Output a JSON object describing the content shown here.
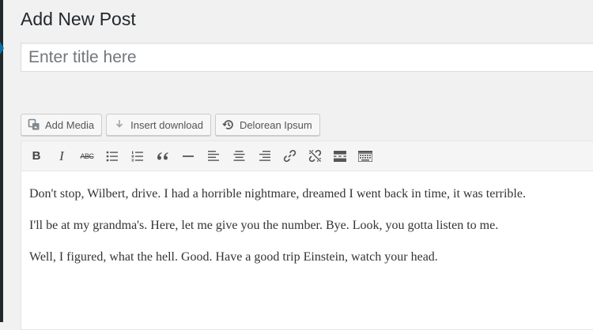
{
  "page": {
    "title": "Add New Post"
  },
  "title_field": {
    "placeholder": "Enter title here",
    "value": ""
  },
  "media_buttons": [
    {
      "label": "Add Media",
      "icon": "media-icon"
    },
    {
      "label": "Insert download",
      "icon": "download-icon"
    },
    {
      "label": "Delorean Ipsum",
      "icon": "history-icon"
    }
  ],
  "toolbar": {
    "bold": "B",
    "italic": "I",
    "strikethrough": "ABC",
    "buttons": [
      "bold",
      "italic",
      "strikethrough",
      "bulleted-list",
      "numbered-list",
      "blockquote",
      "horizontal-line",
      "align-left",
      "align-center",
      "align-right",
      "insert-link",
      "remove-link",
      "read-more-tag",
      "toolbar-toggle"
    ]
  },
  "content": {
    "paragraphs": [
      "Don't stop, Wilbert, drive. I had a horrible nightmare, dreamed I went back in time, it was terrible.",
      "I'll be at my grandma's. Here, let me give you the number. Bye. Look, you gotta listen to me.",
      "Well, I figured, what the hell. Good. Have a good trip Einstein, watch your head."
    ]
  },
  "colors": {
    "background": "#f1f1f1",
    "admin_menu": "#23282d",
    "admin_accent": "#0073aa",
    "text": "#23282d"
  }
}
